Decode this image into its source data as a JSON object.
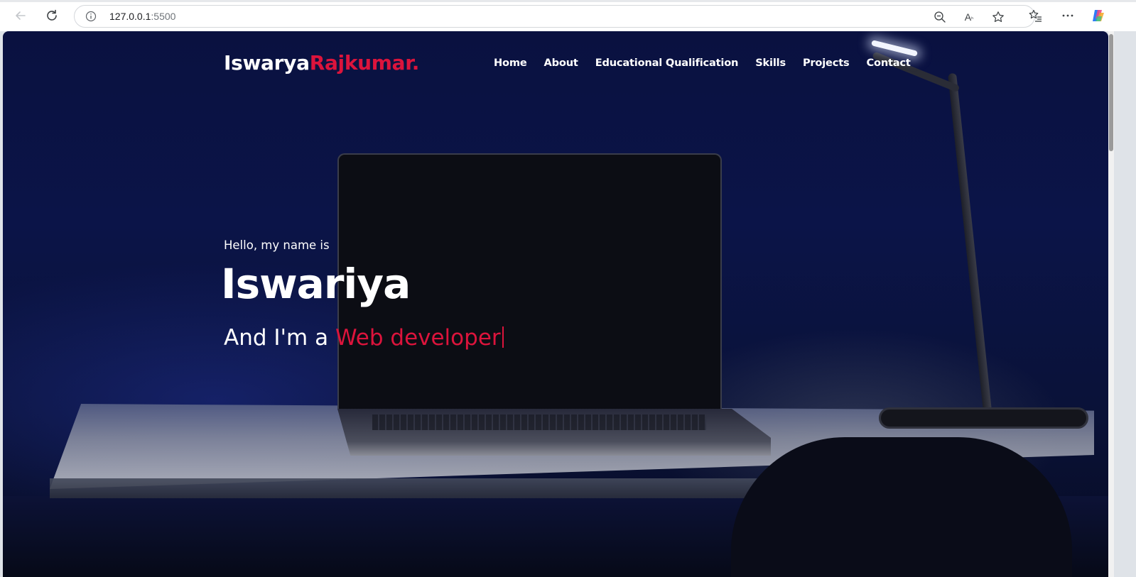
{
  "browser": {
    "url_host": "127.0.0.1",
    "url_port": ":5500"
  },
  "site": {
    "logo_first": "Iswarya",
    "logo_second": "Rajkumar.",
    "nav": [
      {
        "label": "Home"
      },
      {
        "label": "About"
      },
      {
        "label": "Educational Qualification"
      },
      {
        "label": "Skills"
      },
      {
        "label": "Projects"
      },
      {
        "label": "Contact"
      }
    ]
  },
  "hero": {
    "intro": "Hello, my name is",
    "name": "Iswariya",
    "role_prefix": "And I'm a ",
    "role_typed": "Web developer"
  },
  "colors": {
    "accent": "#dc143c",
    "text": "#ffffff",
    "background": "#0a1140"
  }
}
